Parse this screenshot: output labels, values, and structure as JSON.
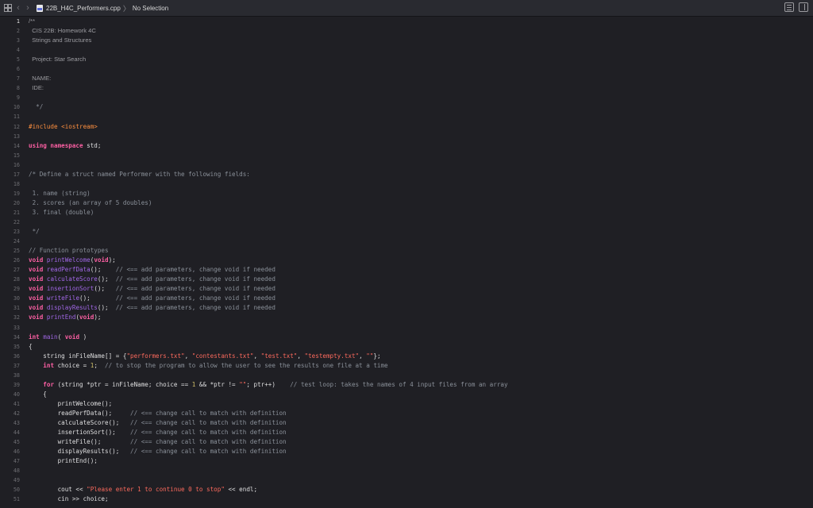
{
  "toolbar": {
    "file_name": "22B_H4C_Performers.cpp",
    "separator": "〉",
    "selection": "No Selection",
    "grid_icon": "grid-icon",
    "back_icon": "chevron-left-icon",
    "forward_icon": "chevron-right-icon"
  },
  "editor": {
    "current_line": 1,
    "lines": [
      {
        "n": "1",
        "t": [
          {
            "c": "/**",
            "k": "doc"
          }
        ]
      },
      {
        "n": "2",
        "t": [
          {
            "c": "  CIS 22B: Homework 4C",
            "k": "doc"
          }
        ]
      },
      {
        "n": "3",
        "t": [
          {
            "c": "  Strings and Structures",
            "k": "doc"
          }
        ]
      },
      {
        "n": "4",
        "t": []
      },
      {
        "n": "5",
        "t": [
          {
            "c": "  Project: Star Search",
            "k": "doc"
          }
        ]
      },
      {
        "n": "6",
        "t": []
      },
      {
        "n": "7",
        "t": [
          {
            "c": "  NAME:",
            "k": "doc"
          }
        ]
      },
      {
        "n": "8",
        "t": [
          {
            "c": "  IDE:",
            "k": "doc"
          }
        ]
      },
      {
        "n": "9",
        "t": []
      },
      {
        "n": "10",
        "t": [
          {
            "c": "  */",
            "k": "com"
          }
        ]
      },
      {
        "n": "11",
        "t": []
      },
      {
        "n": "12",
        "t": [
          {
            "c": "#include <iostream>",
            "k": "pp"
          }
        ]
      },
      {
        "n": "13",
        "t": []
      },
      {
        "n": "14",
        "t": [
          {
            "c": "using namespace",
            "k": "kw"
          },
          {
            "c": " std;",
            "k": "pl"
          }
        ]
      },
      {
        "n": "15",
        "t": []
      },
      {
        "n": "16",
        "t": []
      },
      {
        "n": "17",
        "t": [
          {
            "c": "/* Define a struct named Performer with the following fields:",
            "k": "com"
          }
        ]
      },
      {
        "n": "18",
        "t": []
      },
      {
        "n": "19",
        "t": [
          {
            "c": " 1. name (string)",
            "k": "com"
          }
        ]
      },
      {
        "n": "20",
        "t": [
          {
            "c": " 2. scores (an array of 5 doubles)",
            "k": "com"
          }
        ]
      },
      {
        "n": "21",
        "t": [
          {
            "c": " 3. final (double)",
            "k": "com"
          }
        ]
      },
      {
        "n": "22",
        "t": []
      },
      {
        "n": "23",
        "t": [
          {
            "c": " */",
            "k": "com"
          }
        ]
      },
      {
        "n": "24",
        "t": []
      },
      {
        "n": "25",
        "t": [
          {
            "c": "// Function prototypes",
            "k": "com"
          }
        ]
      },
      {
        "n": "26",
        "t": [
          {
            "c": "void",
            "k": "kw"
          },
          {
            "c": " printWelcome",
            "k": "fn"
          },
          {
            "c": "(",
            "k": "pl"
          },
          {
            "c": "void",
            "k": "kw"
          },
          {
            "c": ");",
            "k": "pl"
          }
        ]
      },
      {
        "n": "27",
        "t": [
          {
            "c": "void",
            "k": "kw"
          },
          {
            "c": " readPerfData",
            "k": "fn"
          },
          {
            "c": "();    ",
            "k": "pl"
          },
          {
            "c": "// <== add parameters, change void if needed",
            "k": "com"
          }
        ]
      },
      {
        "n": "28",
        "t": [
          {
            "c": "void",
            "k": "kw"
          },
          {
            "c": " calculateScore",
            "k": "fn"
          },
          {
            "c": "();  ",
            "k": "pl"
          },
          {
            "c": "// <== add parameters, change void if needed",
            "k": "com"
          }
        ]
      },
      {
        "n": "29",
        "t": [
          {
            "c": "void",
            "k": "kw"
          },
          {
            "c": " insertionSort",
            "k": "fn"
          },
          {
            "c": "();   ",
            "k": "pl"
          },
          {
            "c": "// <== add parameters, change void if needed",
            "k": "com"
          }
        ]
      },
      {
        "n": "30",
        "t": [
          {
            "c": "void",
            "k": "kw"
          },
          {
            "c": " writeFile",
            "k": "fn"
          },
          {
            "c": "();       ",
            "k": "pl"
          },
          {
            "c": "// <== add parameters, change void if needed",
            "k": "com"
          }
        ]
      },
      {
        "n": "31",
        "t": [
          {
            "c": "void",
            "k": "kw"
          },
          {
            "c": " displayResults",
            "k": "fn"
          },
          {
            "c": "();  ",
            "k": "pl"
          },
          {
            "c": "// <== add parameters, change void if needed",
            "k": "com"
          }
        ]
      },
      {
        "n": "32",
        "t": [
          {
            "c": "void",
            "k": "kw"
          },
          {
            "c": " printEnd",
            "k": "fn"
          },
          {
            "c": "(",
            "k": "pl"
          },
          {
            "c": "void",
            "k": "kw"
          },
          {
            "c": ");",
            "k": "pl"
          }
        ]
      },
      {
        "n": "33",
        "t": []
      },
      {
        "n": "34",
        "t": [
          {
            "c": "int",
            "k": "kw"
          },
          {
            "c": " main",
            "k": "fn"
          },
          {
            "c": "( ",
            "k": "pl"
          },
          {
            "c": "void",
            "k": "kw"
          },
          {
            "c": " )",
            "k": "pl"
          }
        ]
      },
      {
        "n": "35",
        "t": [
          {
            "c": "{",
            "k": "pl"
          }
        ]
      },
      {
        "n": "36",
        "t": [
          {
            "c": "    string inFileName[] = {",
            "k": "pl"
          },
          {
            "c": "\"performers.txt\"",
            "k": "str"
          },
          {
            "c": ", ",
            "k": "pl"
          },
          {
            "c": "\"contestants.txt\"",
            "k": "str"
          },
          {
            "c": ", ",
            "k": "pl"
          },
          {
            "c": "\"test.txt\"",
            "k": "str"
          },
          {
            "c": ", ",
            "k": "pl"
          },
          {
            "c": "\"testempty.txt\"",
            "k": "str"
          },
          {
            "c": ", ",
            "k": "pl"
          },
          {
            "c": "\"\"",
            "k": "str"
          },
          {
            "c": "};",
            "k": "pl"
          }
        ]
      },
      {
        "n": "37",
        "t": [
          {
            "c": "    ",
            "k": "pl"
          },
          {
            "c": "int",
            "k": "kw"
          },
          {
            "c": " choice = ",
            "k": "pl"
          },
          {
            "c": "1",
            "k": "num"
          },
          {
            "c": ";  ",
            "k": "pl"
          },
          {
            "c": "// to stop the program to allow the user to see the results one file at a time",
            "k": "com"
          }
        ]
      },
      {
        "n": "38",
        "t": []
      },
      {
        "n": "39",
        "t": [
          {
            "c": "    ",
            "k": "pl"
          },
          {
            "c": "for",
            "k": "kw"
          },
          {
            "c": " (string *ptr = inFileName; choice == ",
            "k": "pl"
          },
          {
            "c": "1",
            "k": "num"
          },
          {
            "c": " && *ptr != ",
            "k": "pl"
          },
          {
            "c": "\"\"",
            "k": "str"
          },
          {
            "c": "; ptr++)    ",
            "k": "pl"
          },
          {
            "c": "// test loop: takes the names of 4 input files from an array",
            "k": "com"
          }
        ]
      },
      {
        "n": "40",
        "t": [
          {
            "c": "    {",
            "k": "pl"
          }
        ]
      },
      {
        "n": "41",
        "t": [
          {
            "c": "        printWelcome();",
            "k": "pl"
          }
        ]
      },
      {
        "n": "42",
        "t": [
          {
            "c": "        readPerfData();     ",
            "k": "pl"
          },
          {
            "c": "// <== change call to match with definition",
            "k": "com"
          }
        ]
      },
      {
        "n": "43",
        "t": [
          {
            "c": "        calculateScore();   ",
            "k": "pl"
          },
          {
            "c": "// <== change call to match with definition",
            "k": "com"
          }
        ]
      },
      {
        "n": "44",
        "t": [
          {
            "c": "        insertionSort();    ",
            "k": "pl"
          },
          {
            "c": "// <== change call to match with definition",
            "k": "com"
          }
        ]
      },
      {
        "n": "45",
        "t": [
          {
            "c": "        writeFile();        ",
            "k": "pl"
          },
          {
            "c": "// <== change call to match with definition",
            "k": "com"
          }
        ]
      },
      {
        "n": "46",
        "t": [
          {
            "c": "        displayResults();   ",
            "k": "pl"
          },
          {
            "c": "// <== change call to match with definition",
            "k": "com"
          }
        ]
      },
      {
        "n": "47",
        "t": [
          {
            "c": "        printEnd();",
            "k": "pl"
          }
        ]
      },
      {
        "n": "48",
        "t": []
      },
      {
        "n": "49",
        "t": []
      },
      {
        "n": "50",
        "t": [
          {
            "c": "        cout << ",
            "k": "pl"
          },
          {
            "c": "\"Please enter 1 to continue 0 to stop\"",
            "k": "str"
          },
          {
            "c": " << endl;",
            "k": "pl"
          }
        ]
      },
      {
        "n": "51",
        "t": [
          {
            "c": "        cin >> choice;",
            "k": "pl"
          }
        ]
      }
    ]
  }
}
